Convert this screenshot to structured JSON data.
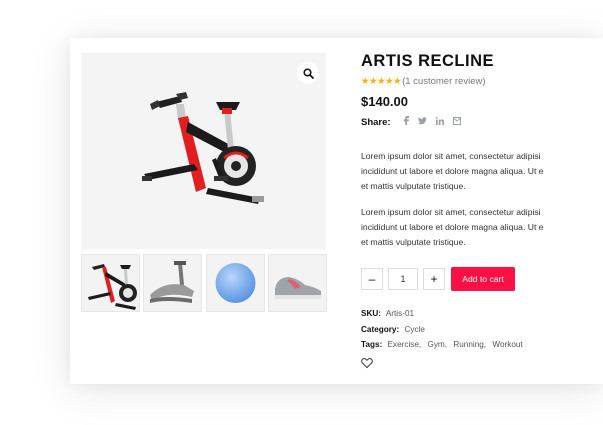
{
  "product": {
    "title": "ARTIS RECLINE",
    "stars": "★★★★★",
    "review_text": "(1 customer review)",
    "price": "$140.00",
    "share_label": "Share:",
    "share_icons": [
      "facebook-icon",
      "twitter-icon",
      "linkedin-icon",
      "email-icon"
    ],
    "description_1": [
      "Lorem ipsum dolor sit amet, consectetur adipisi",
      "incididunt ut labore et dolore magna aliqua. Ut e",
      "et mattis vulputate tristique."
    ],
    "description_2": [
      "Lorem ipsum dolor sit amet, consectetur adipisi",
      "incididunt ut labore et dolore magna aliqua. Ut e",
      "et mattis vulputate tristique."
    ],
    "quantity": "1",
    "minus_label": "–",
    "plus_label": "+",
    "add_to_cart": "Add to cart",
    "sku_label": "SKU:",
    "sku": "Artis-01",
    "category_label": "Category:",
    "category": "Cycle",
    "tags_label": "Tags:",
    "tags": [
      "Exercise,",
      "Gym,",
      "Running,",
      "Workout"
    ]
  },
  "gallery": {
    "thumbnails": [
      "exercise-bike",
      "treadmill",
      "exercise-ball",
      "sneaker"
    ]
  },
  "colors": {
    "accent": "#fe0f44",
    "stars": "#f5b301",
    "bike_red": "#e02020"
  }
}
